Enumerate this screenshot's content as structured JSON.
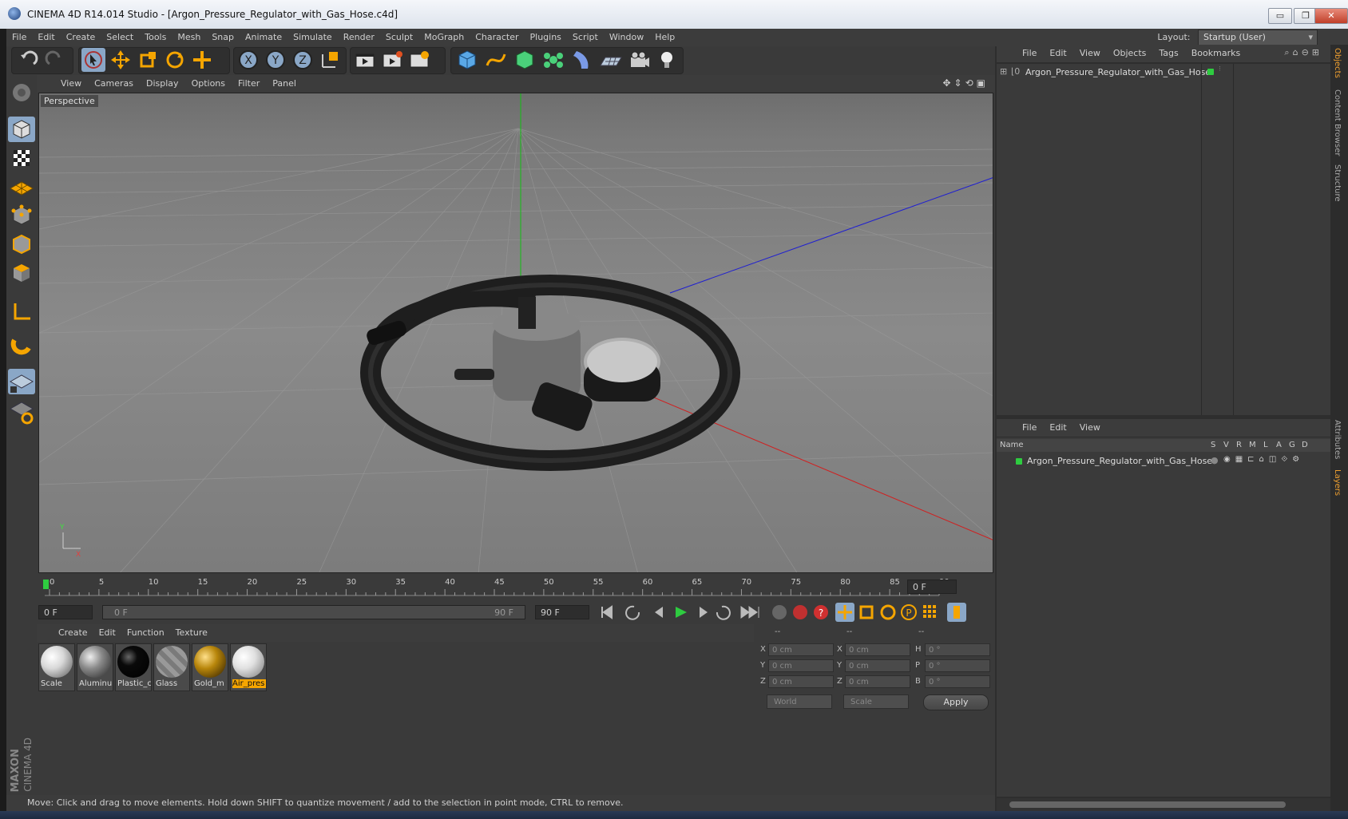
{
  "window": {
    "title": "CINEMA 4D R14.014 Studio - [Argon_Pressure_Regulator_with_Gas_Hose.c4d]",
    "controls": {
      "minimize": "▭",
      "maximize": "❐",
      "close": "✕"
    }
  },
  "menubar": {
    "items": [
      "File",
      "Edit",
      "Create",
      "Select",
      "Tools",
      "Mesh",
      "Snap",
      "Animate",
      "Simulate",
      "Render",
      "Sculpt",
      "MoGraph",
      "Character",
      "Plugins",
      "Script",
      "Window",
      "Help"
    ],
    "layout_label": "Layout:",
    "layout_value": "Startup (User)"
  },
  "viewport": {
    "menu": [
      "View",
      "Cameras",
      "Display",
      "Options",
      "Filter",
      "Panel"
    ],
    "label": "Perspective",
    "axis_y": "Y",
    "axis_x": "X"
  },
  "timeline": {
    "ticks": [
      "0",
      "5",
      "10",
      "15",
      "20",
      "25",
      "30",
      "35",
      "40",
      "45",
      "50",
      "55",
      "60",
      "65",
      "70",
      "75",
      "80",
      "85",
      "90"
    ],
    "current_frame": "0 F",
    "start_field": "0 F",
    "range_start": "0 F",
    "range_end": "90 F",
    "end_field": "90 F"
  },
  "materials": {
    "menu": [
      "Create",
      "Edit",
      "Function",
      "Texture"
    ],
    "items": [
      {
        "name": "Scale",
        "color": "#d8d8d8"
      },
      {
        "name": "Aluminu",
        "color": "#8a8a8a"
      },
      {
        "name": "Plastic_c",
        "color": "#0a0a0a"
      },
      {
        "name": "Glass",
        "color": "#7a7a7a"
      },
      {
        "name": "Gold_m",
        "color": "#b8860b"
      },
      {
        "name": "Air_pres",
        "color": "#e0e0e0"
      }
    ]
  },
  "coords": {
    "headers": [
      "--",
      "--",
      "--"
    ],
    "pos_labels": [
      "X",
      "Y",
      "Z"
    ],
    "size_labels": [
      "X",
      "Y",
      "Z"
    ],
    "rot_labels": [
      "H",
      "P",
      "B"
    ],
    "pos_values": [
      "0 cm",
      "0 cm",
      "0 cm"
    ],
    "size_values": [
      "0 cm",
      "0 cm",
      "0 cm"
    ],
    "rot_values": [
      "0 °",
      "0 °",
      "0 °"
    ],
    "mode1": "World",
    "mode2": "Scale",
    "apply": "Apply"
  },
  "objects": {
    "menu": [
      "File",
      "Edit",
      "View",
      "Objects",
      "Tags",
      "Bookmarks"
    ],
    "tree_item": "Argon_Pressure_Regulator_with_Gas_Hose"
  },
  "layers": {
    "menu": [
      "File",
      "Edit",
      "View"
    ],
    "columns": [
      "Name",
      "S",
      "V",
      "R",
      "M",
      "L",
      "A",
      "G",
      "D"
    ],
    "row_name": "Argon_Pressure_Regulator_with_Gas_Hose"
  },
  "sidetabs": [
    "Objects",
    "Content Browser",
    "Structure",
    "Attributes",
    "Layers"
  ],
  "status": "Move: Click and drag to move elements. Hold down SHIFT to quantize movement / add to the selection in point mode, CTRL to remove.",
  "brand": {
    "maxon": "MAXON",
    "c4d": "CINEMA 4D"
  },
  "colors": {
    "accent": "#f5a500",
    "selected_tool": "#8aa7c7",
    "layer_green": "#2ecc40"
  }
}
